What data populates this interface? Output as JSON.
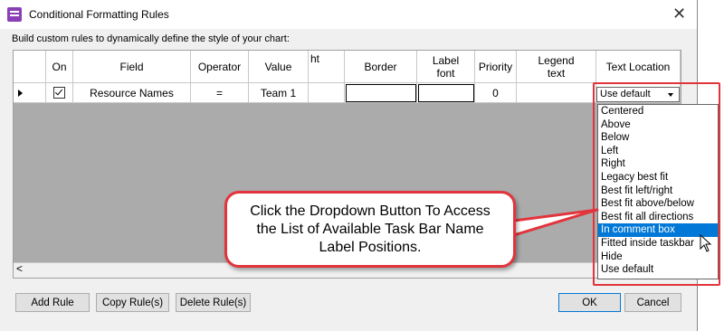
{
  "window": {
    "title": "Conditional Formatting Rules",
    "subtitle": "Build custom rules to dynamically define the style of your chart:",
    "close_icon": "close-icon"
  },
  "grid": {
    "columns": [
      "",
      "On",
      "Field",
      "Operator",
      "Value",
      "ht",
      "Border",
      "Label\nfont",
      "Priority",
      "Legend\ntext",
      "Text Location"
    ],
    "rows": [
      {
        "indicator": "row-arrow",
        "on": true,
        "field": "Resource Names",
        "operator": "=",
        "value": "Team 1",
        "ht": "",
        "border": "",
        "label_font": "",
        "priority": "0",
        "legend_text": "",
        "text_location": "Use default"
      }
    ]
  },
  "dropdown": {
    "options": [
      "Centered",
      "Above",
      "Below",
      "Left",
      "Right",
      "Legacy best fit",
      "Best fit left/right",
      "Best fit above/below",
      "Best fit all directions",
      "In comment box",
      "Fitted inside taskbar",
      "Hide",
      "Use default"
    ],
    "highlighted_index": 9
  },
  "callout": {
    "text": "Click the Dropdown Button To Access the List of Available Task Bar Name Label Positions."
  },
  "buttons": {
    "add_rule": "Add Rule",
    "copy_rules": "Copy Rule(s)",
    "delete_rules": "Delete Rule(s)",
    "ok": "OK",
    "cancel": "Cancel"
  },
  "colors": {
    "highlight": "#0078d7",
    "callout_border": "#e2343c",
    "grid_background": "#ababab"
  }
}
